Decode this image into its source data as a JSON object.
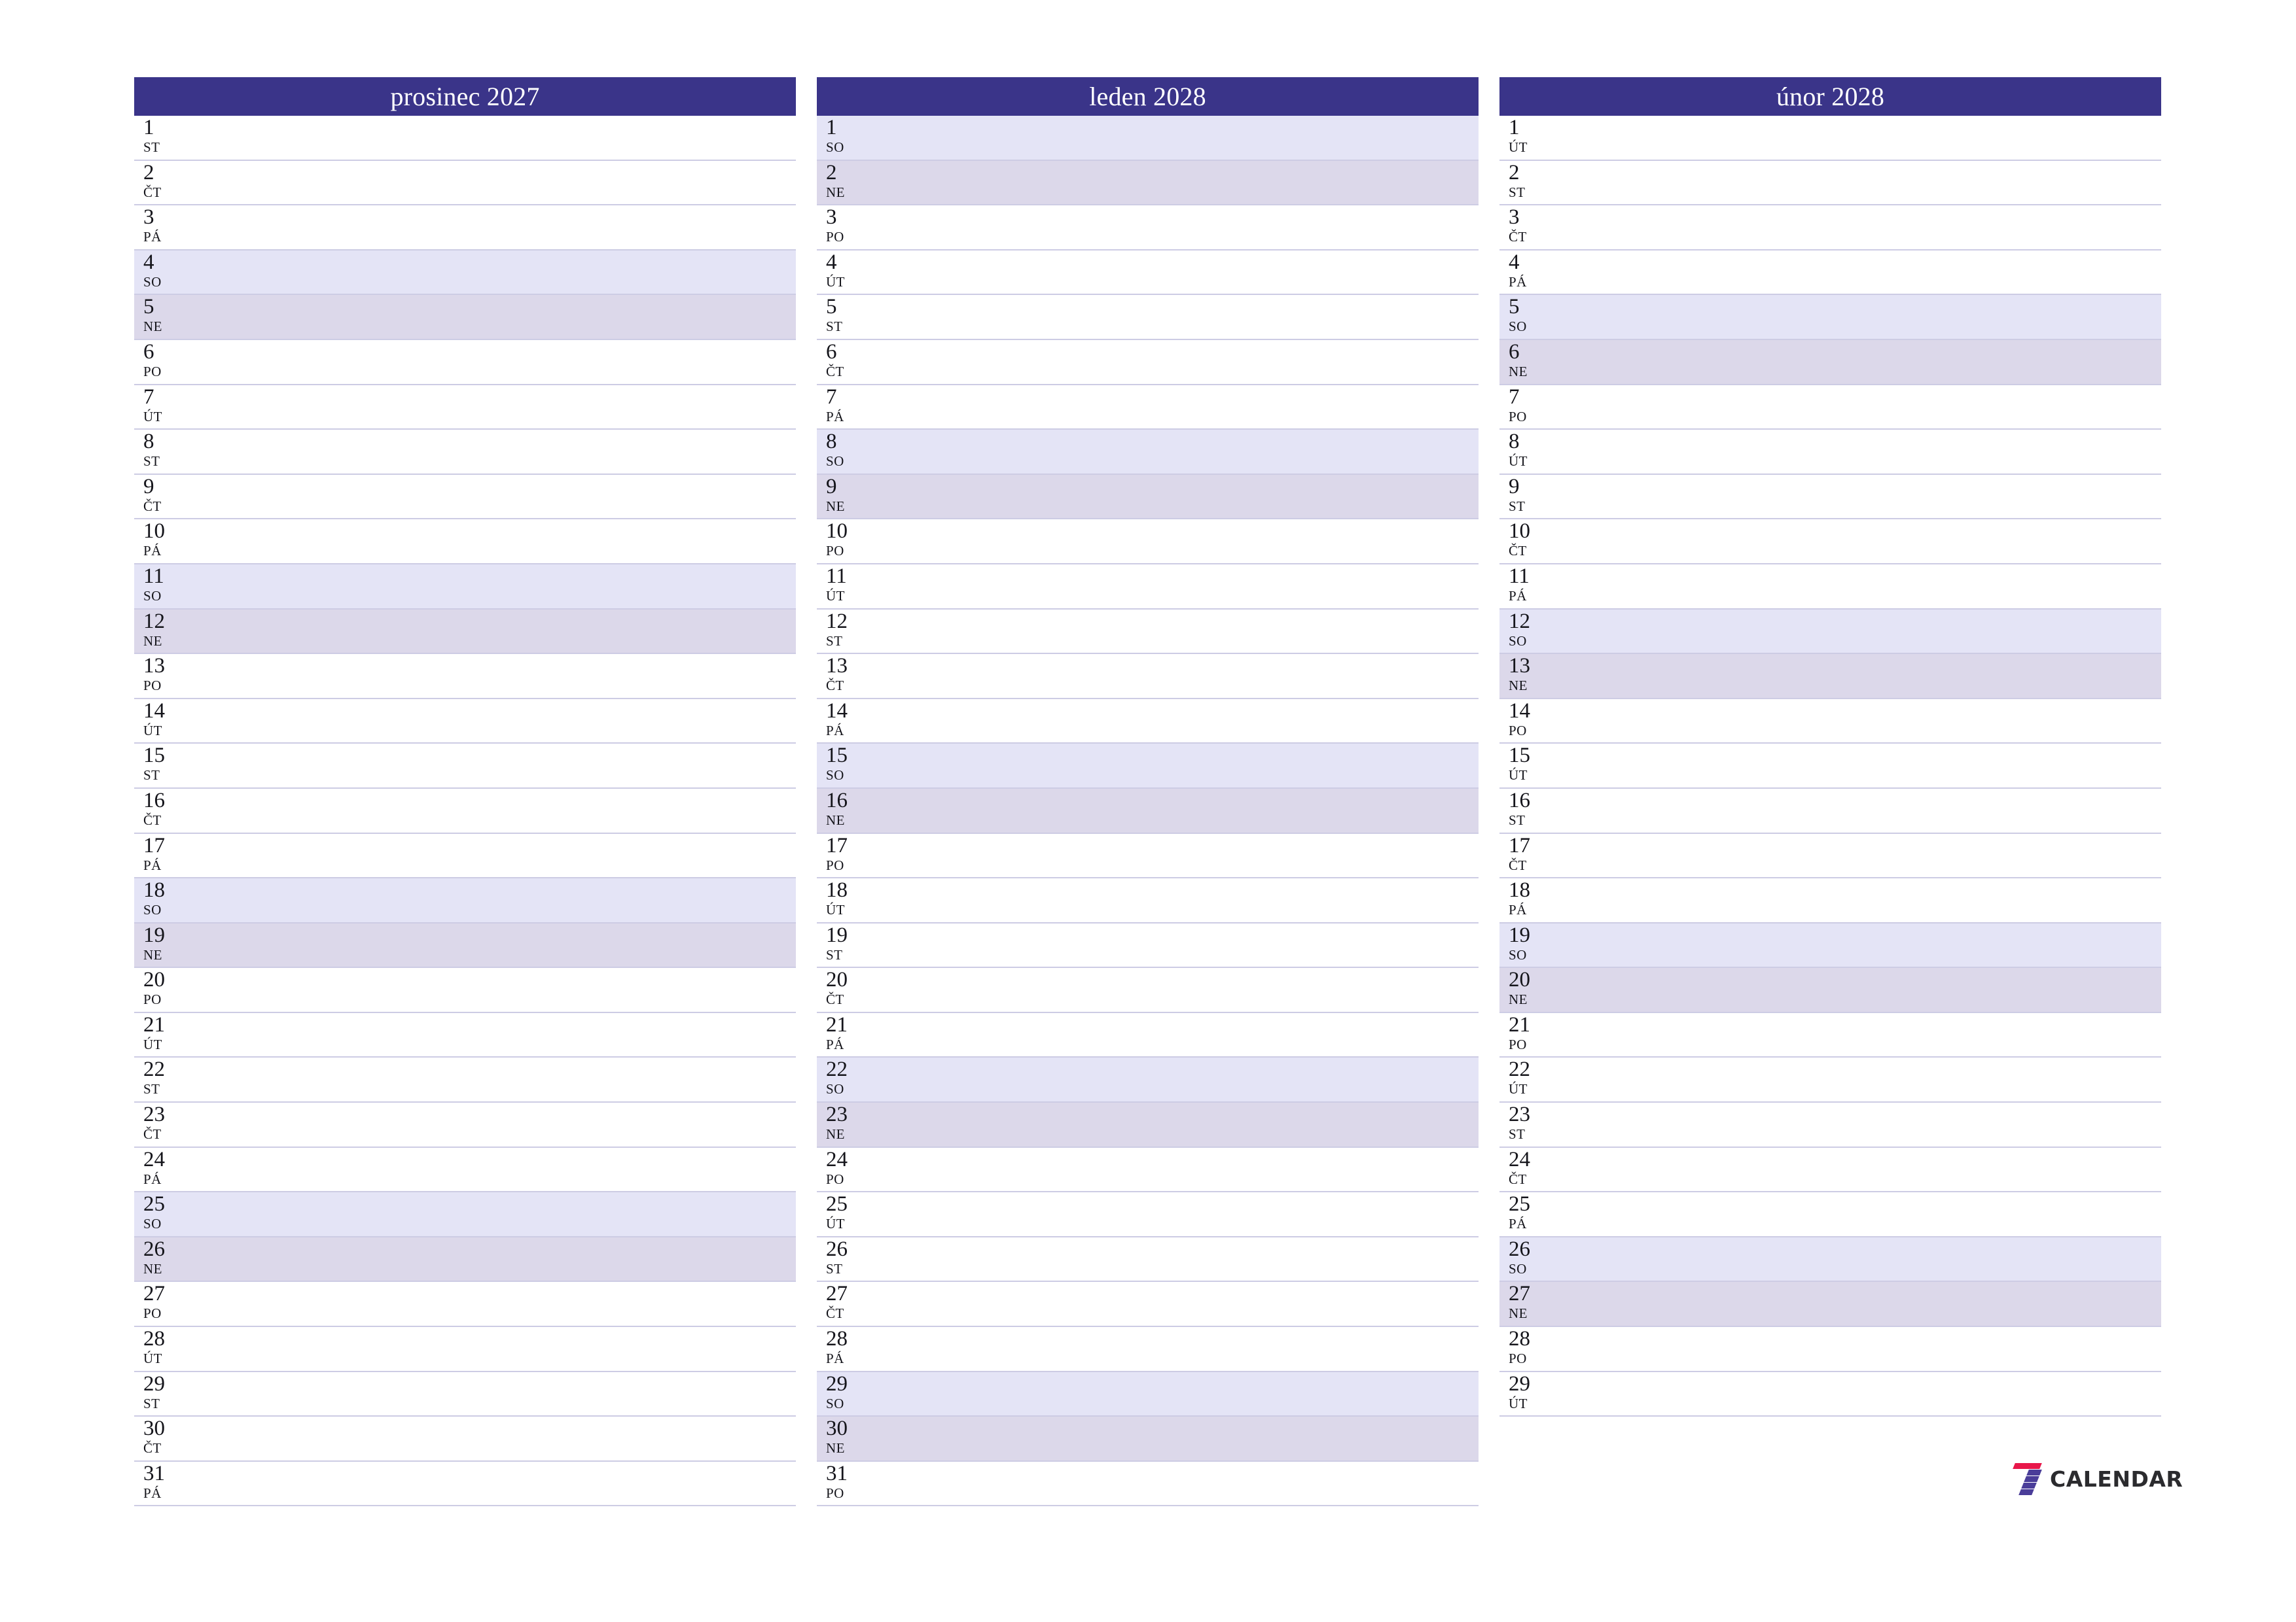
{
  "page": {
    "background_color": "#ffffff",
    "header_color": "#3a3489",
    "saturday_color": "#e4e4f6",
    "sunday_color": "#dcd8ea",
    "separator_color": "#cdcce4",
    "text_color": "#15151b"
  },
  "brand": {
    "logo_icon": "seven-stripes-icon",
    "word": "CALENDAR",
    "accent_red": "#e8174a",
    "accent_purple": "#4a3d99"
  },
  "months": [
    {
      "title": "prosinec 2027",
      "days": [
        {
          "num": "1",
          "dow": "ST",
          "type": "weekday"
        },
        {
          "num": "2",
          "dow": "ČT",
          "type": "weekday"
        },
        {
          "num": "3",
          "dow": "PÁ",
          "type": "weekday"
        },
        {
          "num": "4",
          "dow": "SO",
          "type": "sat"
        },
        {
          "num": "5",
          "dow": "NE",
          "type": "sun"
        },
        {
          "num": "6",
          "dow": "PO",
          "type": "weekday"
        },
        {
          "num": "7",
          "dow": "ÚT",
          "type": "weekday"
        },
        {
          "num": "8",
          "dow": "ST",
          "type": "weekday"
        },
        {
          "num": "9",
          "dow": "ČT",
          "type": "weekday"
        },
        {
          "num": "10",
          "dow": "PÁ",
          "type": "weekday"
        },
        {
          "num": "11",
          "dow": "SO",
          "type": "sat"
        },
        {
          "num": "12",
          "dow": "NE",
          "type": "sun"
        },
        {
          "num": "13",
          "dow": "PO",
          "type": "weekday"
        },
        {
          "num": "14",
          "dow": "ÚT",
          "type": "weekday"
        },
        {
          "num": "15",
          "dow": "ST",
          "type": "weekday"
        },
        {
          "num": "16",
          "dow": "ČT",
          "type": "weekday"
        },
        {
          "num": "17",
          "dow": "PÁ",
          "type": "weekday"
        },
        {
          "num": "18",
          "dow": "SO",
          "type": "sat"
        },
        {
          "num": "19",
          "dow": "NE",
          "type": "sun"
        },
        {
          "num": "20",
          "dow": "PO",
          "type": "weekday"
        },
        {
          "num": "21",
          "dow": "ÚT",
          "type": "weekday"
        },
        {
          "num": "22",
          "dow": "ST",
          "type": "weekday"
        },
        {
          "num": "23",
          "dow": "ČT",
          "type": "weekday"
        },
        {
          "num": "24",
          "dow": "PÁ",
          "type": "weekday"
        },
        {
          "num": "25",
          "dow": "SO",
          "type": "sat"
        },
        {
          "num": "26",
          "dow": "NE",
          "type": "sun"
        },
        {
          "num": "27",
          "dow": "PO",
          "type": "weekday"
        },
        {
          "num": "28",
          "dow": "ÚT",
          "type": "weekday"
        },
        {
          "num": "29",
          "dow": "ST",
          "type": "weekday"
        },
        {
          "num": "30",
          "dow": "ČT",
          "type": "weekday"
        },
        {
          "num": "31",
          "dow": "PÁ",
          "type": "weekday"
        }
      ]
    },
    {
      "title": "leden 2028",
      "days": [
        {
          "num": "1",
          "dow": "SO",
          "type": "sat"
        },
        {
          "num": "2",
          "dow": "NE",
          "type": "sun"
        },
        {
          "num": "3",
          "dow": "PO",
          "type": "weekday"
        },
        {
          "num": "4",
          "dow": "ÚT",
          "type": "weekday"
        },
        {
          "num": "5",
          "dow": "ST",
          "type": "weekday"
        },
        {
          "num": "6",
          "dow": "ČT",
          "type": "weekday"
        },
        {
          "num": "7",
          "dow": "PÁ",
          "type": "weekday"
        },
        {
          "num": "8",
          "dow": "SO",
          "type": "sat"
        },
        {
          "num": "9",
          "dow": "NE",
          "type": "sun"
        },
        {
          "num": "10",
          "dow": "PO",
          "type": "weekday"
        },
        {
          "num": "11",
          "dow": "ÚT",
          "type": "weekday"
        },
        {
          "num": "12",
          "dow": "ST",
          "type": "weekday"
        },
        {
          "num": "13",
          "dow": "ČT",
          "type": "weekday"
        },
        {
          "num": "14",
          "dow": "PÁ",
          "type": "weekday"
        },
        {
          "num": "15",
          "dow": "SO",
          "type": "sat"
        },
        {
          "num": "16",
          "dow": "NE",
          "type": "sun"
        },
        {
          "num": "17",
          "dow": "PO",
          "type": "weekday"
        },
        {
          "num": "18",
          "dow": "ÚT",
          "type": "weekday"
        },
        {
          "num": "19",
          "dow": "ST",
          "type": "weekday"
        },
        {
          "num": "20",
          "dow": "ČT",
          "type": "weekday"
        },
        {
          "num": "21",
          "dow": "PÁ",
          "type": "weekday"
        },
        {
          "num": "22",
          "dow": "SO",
          "type": "sat"
        },
        {
          "num": "23",
          "dow": "NE",
          "type": "sun"
        },
        {
          "num": "24",
          "dow": "PO",
          "type": "weekday"
        },
        {
          "num": "25",
          "dow": "ÚT",
          "type": "weekday"
        },
        {
          "num": "26",
          "dow": "ST",
          "type": "weekday"
        },
        {
          "num": "27",
          "dow": "ČT",
          "type": "weekday"
        },
        {
          "num": "28",
          "dow": "PÁ",
          "type": "weekday"
        },
        {
          "num": "29",
          "dow": "SO",
          "type": "sat"
        },
        {
          "num": "30",
          "dow": "NE",
          "type": "sun"
        },
        {
          "num": "31",
          "dow": "PO",
          "type": "weekday"
        }
      ]
    },
    {
      "title": "únor 2028",
      "days": [
        {
          "num": "1",
          "dow": "ÚT",
          "type": "weekday"
        },
        {
          "num": "2",
          "dow": "ST",
          "type": "weekday"
        },
        {
          "num": "3",
          "dow": "ČT",
          "type": "weekday"
        },
        {
          "num": "4",
          "dow": "PÁ",
          "type": "weekday"
        },
        {
          "num": "5",
          "dow": "SO",
          "type": "sat"
        },
        {
          "num": "6",
          "dow": "NE",
          "type": "sun"
        },
        {
          "num": "7",
          "dow": "PO",
          "type": "weekday"
        },
        {
          "num": "8",
          "dow": "ÚT",
          "type": "weekday"
        },
        {
          "num": "9",
          "dow": "ST",
          "type": "weekday"
        },
        {
          "num": "10",
          "dow": "ČT",
          "type": "weekday"
        },
        {
          "num": "11",
          "dow": "PÁ",
          "type": "weekday"
        },
        {
          "num": "12",
          "dow": "SO",
          "type": "sat"
        },
        {
          "num": "13",
          "dow": "NE",
          "type": "sun"
        },
        {
          "num": "14",
          "dow": "PO",
          "type": "weekday"
        },
        {
          "num": "15",
          "dow": "ÚT",
          "type": "weekday"
        },
        {
          "num": "16",
          "dow": "ST",
          "type": "weekday"
        },
        {
          "num": "17",
          "dow": "ČT",
          "type": "weekday"
        },
        {
          "num": "18",
          "dow": "PÁ",
          "type": "weekday"
        },
        {
          "num": "19",
          "dow": "SO",
          "type": "sat"
        },
        {
          "num": "20",
          "dow": "NE",
          "type": "sun"
        },
        {
          "num": "21",
          "dow": "PO",
          "type": "weekday"
        },
        {
          "num": "22",
          "dow": "ÚT",
          "type": "weekday"
        },
        {
          "num": "23",
          "dow": "ST",
          "type": "weekday"
        },
        {
          "num": "24",
          "dow": "ČT",
          "type": "weekday"
        },
        {
          "num": "25",
          "dow": "PÁ",
          "type": "weekday"
        },
        {
          "num": "26",
          "dow": "SO",
          "type": "sat"
        },
        {
          "num": "27",
          "dow": "NE",
          "type": "sun"
        },
        {
          "num": "28",
          "dow": "PO",
          "type": "weekday"
        },
        {
          "num": "29",
          "dow": "ÚT",
          "type": "weekday"
        }
      ]
    }
  ]
}
